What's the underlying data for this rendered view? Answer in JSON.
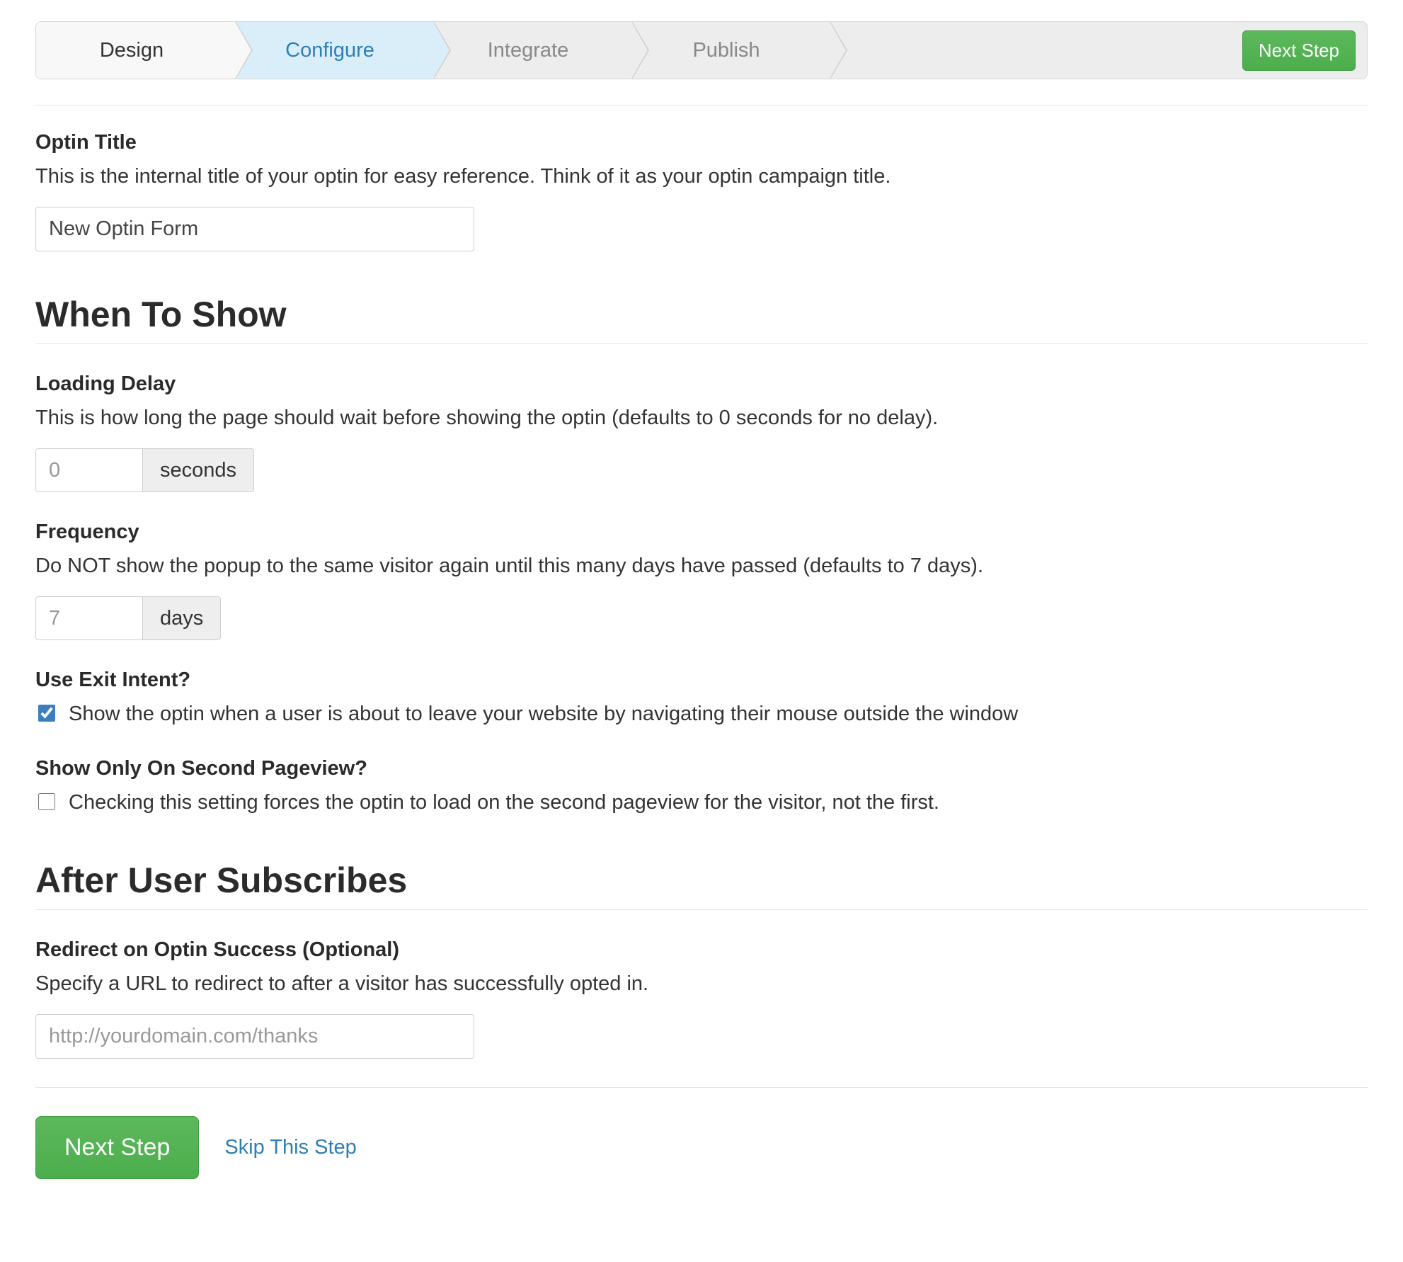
{
  "wizard": {
    "steps": [
      {
        "label": "Design"
      },
      {
        "label": "Configure"
      },
      {
        "label": "Integrate"
      },
      {
        "label": "Publish"
      }
    ],
    "next_label": "Next Step"
  },
  "optin_title": {
    "label": "Optin Title",
    "desc": "This is the internal title of your optin for easy reference. Think of it as your optin campaign title.",
    "value": "New Optin Form"
  },
  "when_to_show": {
    "heading": "When To Show",
    "loading_delay": {
      "label": "Loading Delay",
      "desc": "This is how long the page should wait before showing the optin (defaults to 0 seconds for no delay).",
      "placeholder": "0",
      "unit": "seconds"
    },
    "frequency": {
      "label": "Frequency",
      "desc": "Do NOT show the popup to the same visitor again until this many days have passed (defaults to 7 days).",
      "placeholder": "7",
      "unit": "days"
    },
    "exit_intent": {
      "label": "Use Exit Intent?",
      "checkbox_label": "Show the optin when a user is about to leave your website by navigating their mouse outside the window",
      "checked": true
    },
    "second_pageview": {
      "label": "Show Only On Second Pageview?",
      "checkbox_label": "Checking this setting forces the optin to load on the second pageview for the visitor, not the first.",
      "checked": false
    }
  },
  "after_subscribe": {
    "heading": "After User Subscribes",
    "redirect": {
      "label": "Redirect on Optin Success (Optional)",
      "desc": "Specify a URL to redirect to after a visitor has successfully opted in.",
      "placeholder": "http://yourdomain.com/thanks"
    }
  },
  "footer": {
    "next": "Next Step",
    "skip": "Skip This Step"
  }
}
